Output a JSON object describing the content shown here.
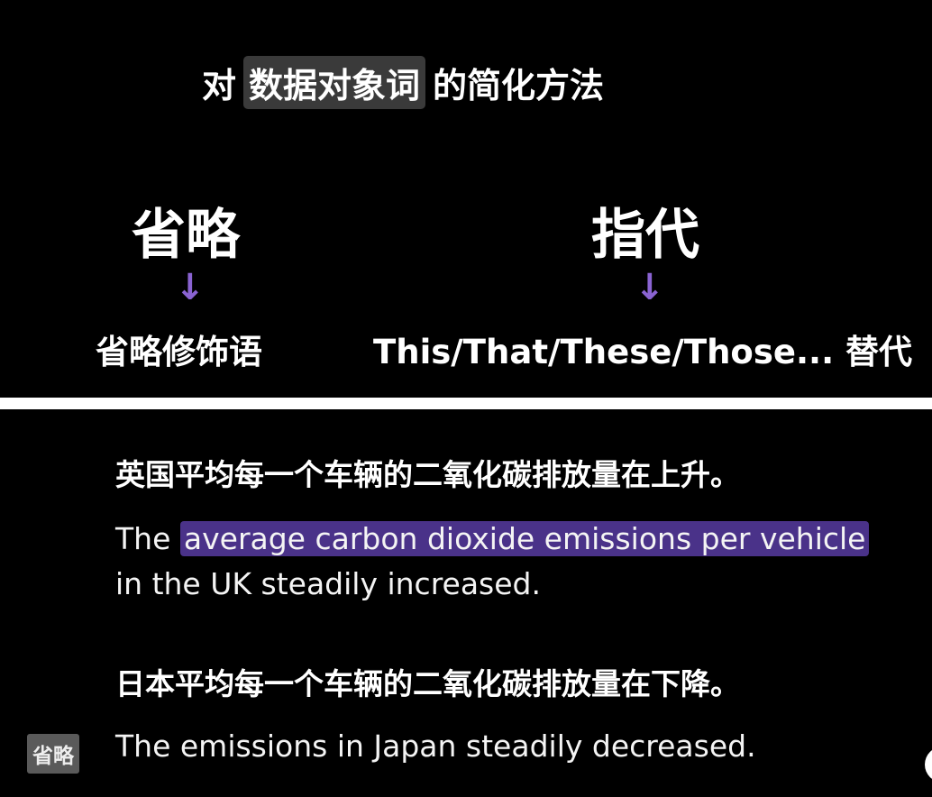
{
  "top": {
    "title_prefix": "对",
    "title_highlight": "数据对象词",
    "title_suffix": "的简化方法",
    "left": {
      "heading": "省略",
      "arrow": "↓",
      "label": "省略修饰语"
    },
    "right": {
      "heading": "指代",
      "arrow": "↓",
      "label": "This/That/These/Those... 替代"
    }
  },
  "bottom": {
    "zh_1": "英国平均每一个车辆的二氧化碳排放量在上升。",
    "en_1_prefix": "The",
    "en_1_highlight": "average carbon dioxide emissions per vehicle",
    "en_1_line2": "in the UK steadily increased.",
    "zh_2": "日本平均每一个车辆的二氧化碳排放量在下降。",
    "tag": "省略",
    "en_2": "The emissions in Japan steadily decreased."
  },
  "colors": {
    "background": "#000000",
    "divider": "#ffffff",
    "arrow": "#8a63d2",
    "highlight_purple": "#4a3289",
    "highlight_gray": "#3a3a3a",
    "tag_gray": "#5a5a5a"
  }
}
